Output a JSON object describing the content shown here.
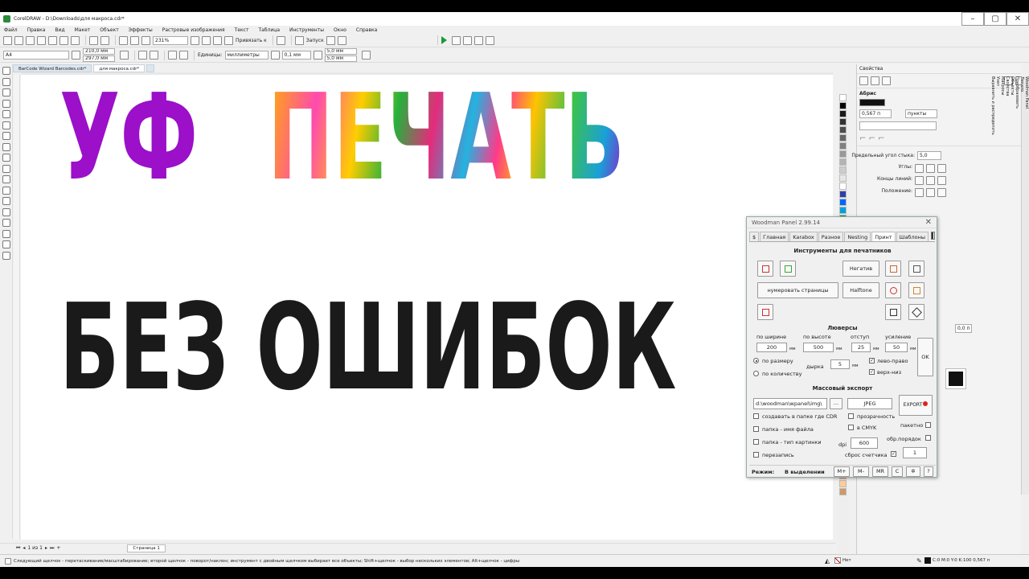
{
  "app": {
    "title": "CorelDRAW - D:\\Downloads\\для макроса.cdr*"
  },
  "menu": [
    "Файл",
    "Правка",
    "Вид",
    "Макет",
    "Объект",
    "Эффекты",
    "Растровые изображения",
    "Текст",
    "Таблица",
    "Инструменты",
    "Окно",
    "Справка"
  ],
  "toolbar1": {
    "zoom": "231%",
    "snap_label": "Привязать к",
    "launch_label": "Запуск"
  },
  "toolbar2": {
    "page_size": "A4",
    "width": "210,0 мм",
    "height": "297,0 мм",
    "units_label": "Единицы:",
    "units_value": "миллиметры",
    "nudge": "0,1 мм",
    "dup_x": "5,0 мм",
    "dup_y": "5,0 мм"
  },
  "doc_tabs": [
    "BarCode Wizard Barcodes.cdr*",
    "для макроса.cdr*"
  ],
  "canvas_text": {
    "line1a": "УФ",
    "line1b": "ПЕЧАТЬ",
    "line2": "БЕЗ ОШИБОК"
  },
  "properties": {
    "title": "Свойства",
    "outline_label": "Абрис",
    "outline_width": "0,567 п",
    "outline_units": "пункты",
    "miter_label": "Предельный угол стыка:",
    "miter_value": "5,0",
    "corners_label": "Углы:",
    "line_ends_label": "Концы линий:",
    "position_label": "Положение:",
    "value_field": "0,0 п"
  },
  "side_tabs": [
    "Woodman Panel",
    "Лекало",
    "Преобразовать",
    "Объекты",
    "Свойства",
    "Макросы",
    "Узел",
    "Выравнить и распределить"
  ],
  "woodman": {
    "title": "Woodman Panel 2.99.14",
    "tabs": [
      "$",
      "Главная",
      "Karabox",
      "Разное",
      "Nesting",
      "Принт",
      "Шаблоны"
    ],
    "section_tools": "Инструменты для печатников",
    "btn_negative": "Негатив",
    "btn_number_pages": "нумеровать страницы",
    "btn_halftone": "Halftone",
    "section_grommets": "Люверсы",
    "lbl_by_width": "по ширине",
    "lbl_by_height": "по высоте",
    "lbl_indent": "отступ",
    "lbl_reinforce": "усиление",
    "val_width": "200",
    "val_height": "500",
    "val_indent": "25",
    "val_reinforce": "50",
    "unit_mm": "мм",
    "radio_by_size": "по размеру",
    "radio_by_count": "по количеству",
    "lbl_hole": "дырка",
    "val_hole": "5",
    "chk_left_right": "лево-право",
    "chk_top_bottom": "верх-низ",
    "btn_ok": "OK",
    "section_export": "Массовый экспорт",
    "export_path": "d:\\woodman\\wpanel\\img\\",
    "browse": "...",
    "format": "JPEG",
    "btn_export": "EXPORT",
    "chk_create_folder": "создавать в папке где CDR",
    "chk_transparency": "прозрачность",
    "chk_folder_name": "папка - имя файла",
    "chk_cmyk": "в CMYK",
    "chk_batch": "пакетно",
    "chk_folder_type": "папка - тип картинки",
    "dpi_label": "dpi",
    "dpi_value": "600",
    "chk_reverse": "обр.порядок",
    "chk_overwrite": "перезапись",
    "chk_reset_counter": "сброс счетчика",
    "counter_value": "1",
    "mode_label": "Режим:",
    "mode_value": "В выделении",
    "btn_mplus": "M+",
    "btn_mminus": "M-",
    "btn_mr": "MR",
    "btn_c": "C",
    "btn_help": "?"
  },
  "pages": {
    "page_counter": "1 из 1",
    "page_tab": "Страница 1"
  },
  "status": {
    "message": "Следующий щелчок - перетаскивание/масштабирование; второй щелчок - поворот/наклон; инструмент с двойным щелчком выбирает все объекты; Shift+щелчок - выбор нескольких элементов; Alt+щелчок - цифры",
    "fill": "Нет",
    "outline": "C:0 M:0 Y:0 K:100  0,567 п"
  }
}
